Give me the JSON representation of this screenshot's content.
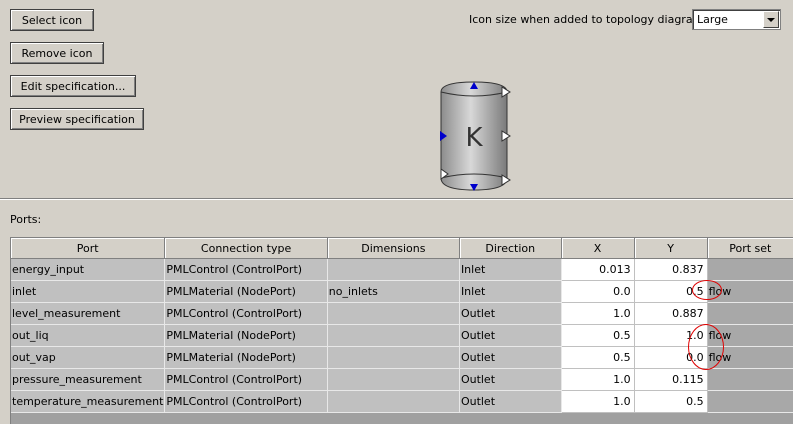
{
  "buttons": {
    "select_icon": "Select icon",
    "remove_icon": "Remove icon",
    "edit_spec": "Edit specification...",
    "preview_spec": "Preview specification"
  },
  "icon_size": {
    "label": "Icon size when added to topology diagrams:",
    "value": "Large"
  },
  "icon_preview": {
    "letter": "K",
    "icon_name": "cylinder-vessel-icon"
  },
  "ports": {
    "label": "Ports:",
    "columns": [
      "Port",
      "Connection type",
      "Dimensions",
      "Direction",
      "X",
      "Y",
      "Port set"
    ],
    "rows": [
      {
        "port": "energy_input",
        "type": "PMLControl (ControlPort)",
        "dims": "",
        "dir": "Inlet",
        "x": "0.013",
        "y": "0.837",
        "set": ""
      },
      {
        "port": "inlet",
        "type": "PMLMaterial (NodePort)",
        "dims": "no_inlets",
        "dir": "Inlet",
        "x": "0.0",
        "y": "0.5",
        "set": "flow"
      },
      {
        "port": "level_measurement",
        "type": "PMLControl (ControlPort)",
        "dims": "",
        "dir": "Outlet",
        "x": "1.0",
        "y": "0.887",
        "set": ""
      },
      {
        "port": "out_liq",
        "type": "PMLMaterial (NodePort)",
        "dims": "",
        "dir": "Outlet",
        "x": "0.5",
        "y": "1.0",
        "set": "flow"
      },
      {
        "port": "out_vap",
        "type": "PMLMaterial (NodePort)",
        "dims": "",
        "dir": "Outlet",
        "x": "0.5",
        "y": "0.0",
        "set": "flow"
      },
      {
        "port": "pressure_measurement",
        "type": "PMLControl (ControlPort)",
        "dims": "",
        "dir": "Outlet",
        "x": "1.0",
        "y": "0.115",
        "set": ""
      },
      {
        "port": "temperature_measurement",
        "type": "PMLControl (ControlPort)",
        "dims": "",
        "dir": "Outlet",
        "x": "1.0",
        "y": "0.5",
        "set": ""
      }
    ]
  },
  "colors": {
    "annotation": "#e00000",
    "port_marker": "#0000cc"
  }
}
